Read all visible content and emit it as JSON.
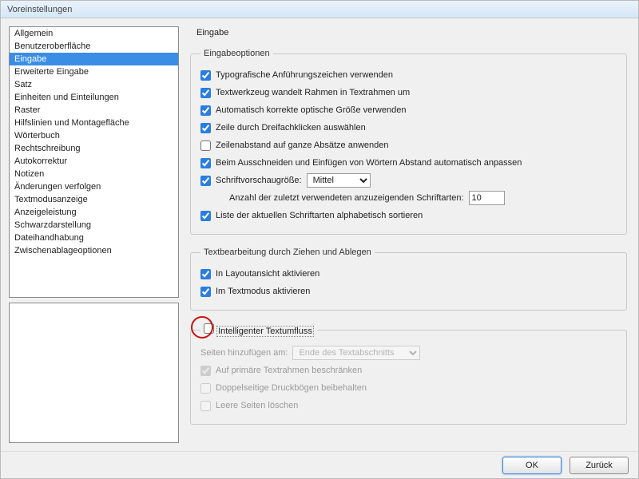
{
  "window": {
    "title": "Voreinstellungen"
  },
  "sidebar": {
    "items": [
      {
        "label": "Allgemein"
      },
      {
        "label": "Benutzeroberfläche"
      },
      {
        "label": "Eingabe",
        "selected": true
      },
      {
        "label": "Erweiterte Eingabe"
      },
      {
        "label": "Satz"
      },
      {
        "label": "Einheiten und Einteilungen"
      },
      {
        "label": "Raster"
      },
      {
        "label": "Hilfslinien und Montagefläche"
      },
      {
        "label": "Wörterbuch"
      },
      {
        "label": "Rechtschreibung"
      },
      {
        "label": "Autokorrektur"
      },
      {
        "label": "Notizen"
      },
      {
        "label": "Änderungen verfolgen"
      },
      {
        "label": "Textmodusanzeige"
      },
      {
        "label": "Anzeigeleistung"
      },
      {
        "label": "Schwarzdarstellung"
      },
      {
        "label": "Dateihandhabung"
      },
      {
        "label": "Zwischenablageoptionen"
      }
    ]
  },
  "main": {
    "heading": "Eingabe",
    "group1": {
      "legend": "Eingabeoptionen",
      "typographic": {
        "label": "Typografische Anführungszeichen verwenden",
        "checked": true
      },
      "textTool": {
        "label": "Textwerkzeug wandelt Rahmen in Textrahmen um",
        "checked": true
      },
      "optical": {
        "label": "Automatisch korrekte optische Größe verwenden",
        "checked": true
      },
      "tripleClick": {
        "label": "Zeile durch Dreifachklicken auswählen",
        "checked": true
      },
      "leading": {
        "label": "Zeilenabstand auf ganze Absätze anwenden",
        "checked": false
      },
      "cutPaste": {
        "label": "Beim Ausschneiden und Einfügen von Wörtern Abstand automatisch anpassen",
        "checked": true
      },
      "previewSize": {
        "label": "Schriftvorschaugröße:",
        "checked": true,
        "value": "Mittel"
      },
      "recentFonts": {
        "label": "Anzahl der zuletzt verwendeten anzuzeigenden Schriftarten:",
        "value": "10"
      },
      "sortFonts": {
        "label": "Liste der aktuellen Schriftarten alphabetisch sortieren",
        "checked": true
      }
    },
    "group2": {
      "legend": "Textbearbeitung durch Ziehen und Ablegen",
      "layout": {
        "label": "In Layoutansicht aktivieren",
        "checked": true
      },
      "textMode": {
        "label": "Im Textmodus aktivieren",
        "checked": true
      }
    },
    "group3": {
      "legend": "Intelligenter Textumfluss",
      "checked": false,
      "addPages": {
        "label": "Seiten hinzufügen am:",
        "value": "Ende des Textabschnitts"
      },
      "primary": {
        "label": "Auf primäre Textrahmen beschränken",
        "checked": true
      },
      "spreads": {
        "label": "Doppelseitige Druckbögen beibehalten",
        "checked": false
      },
      "deleteEmpty": {
        "label": "Leere Seiten löschen",
        "checked": false
      }
    }
  },
  "footer": {
    "ok": "OK",
    "back": "Zurück"
  }
}
